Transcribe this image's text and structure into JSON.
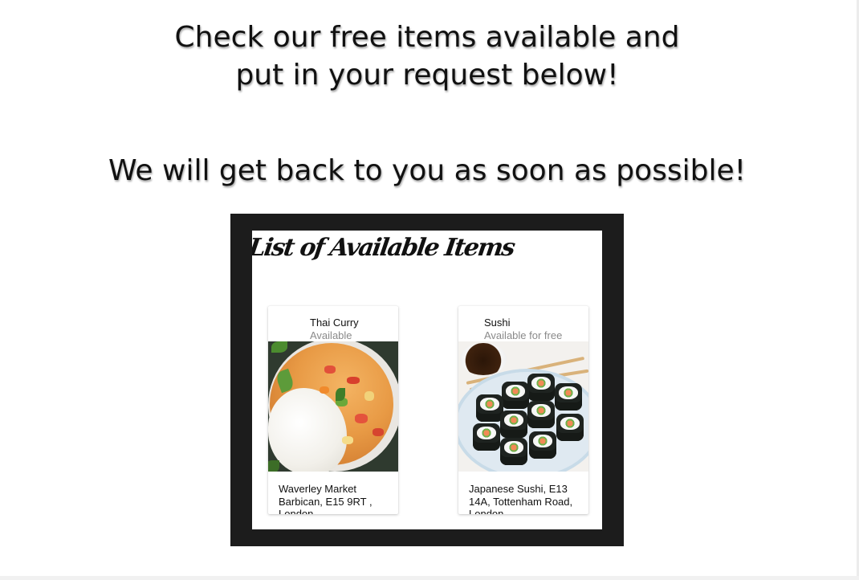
{
  "headline": {
    "line1": "Check our free items available and",
    "line2": "put in your request below!",
    "line3": "We will get back to you as soon as possible!"
  },
  "panel": {
    "title": "List of Available Items"
  },
  "items": [
    {
      "name": "Thai Curry",
      "status": "Available",
      "address_line1": "Waverley Market",
      "address_line2": "Barbican, E15 9RT ,",
      "address_line3": "London"
    },
    {
      "name": "Sushi",
      "status": "Available for free",
      "address_line1": "Japanese Sushi, E13",
      "address_line2": "14A, Tottenham Road,",
      "address_line3": "London"
    }
  ],
  "colors": {
    "frame": "#1c1c1c",
    "status_text": "#8a8a8a"
  }
}
